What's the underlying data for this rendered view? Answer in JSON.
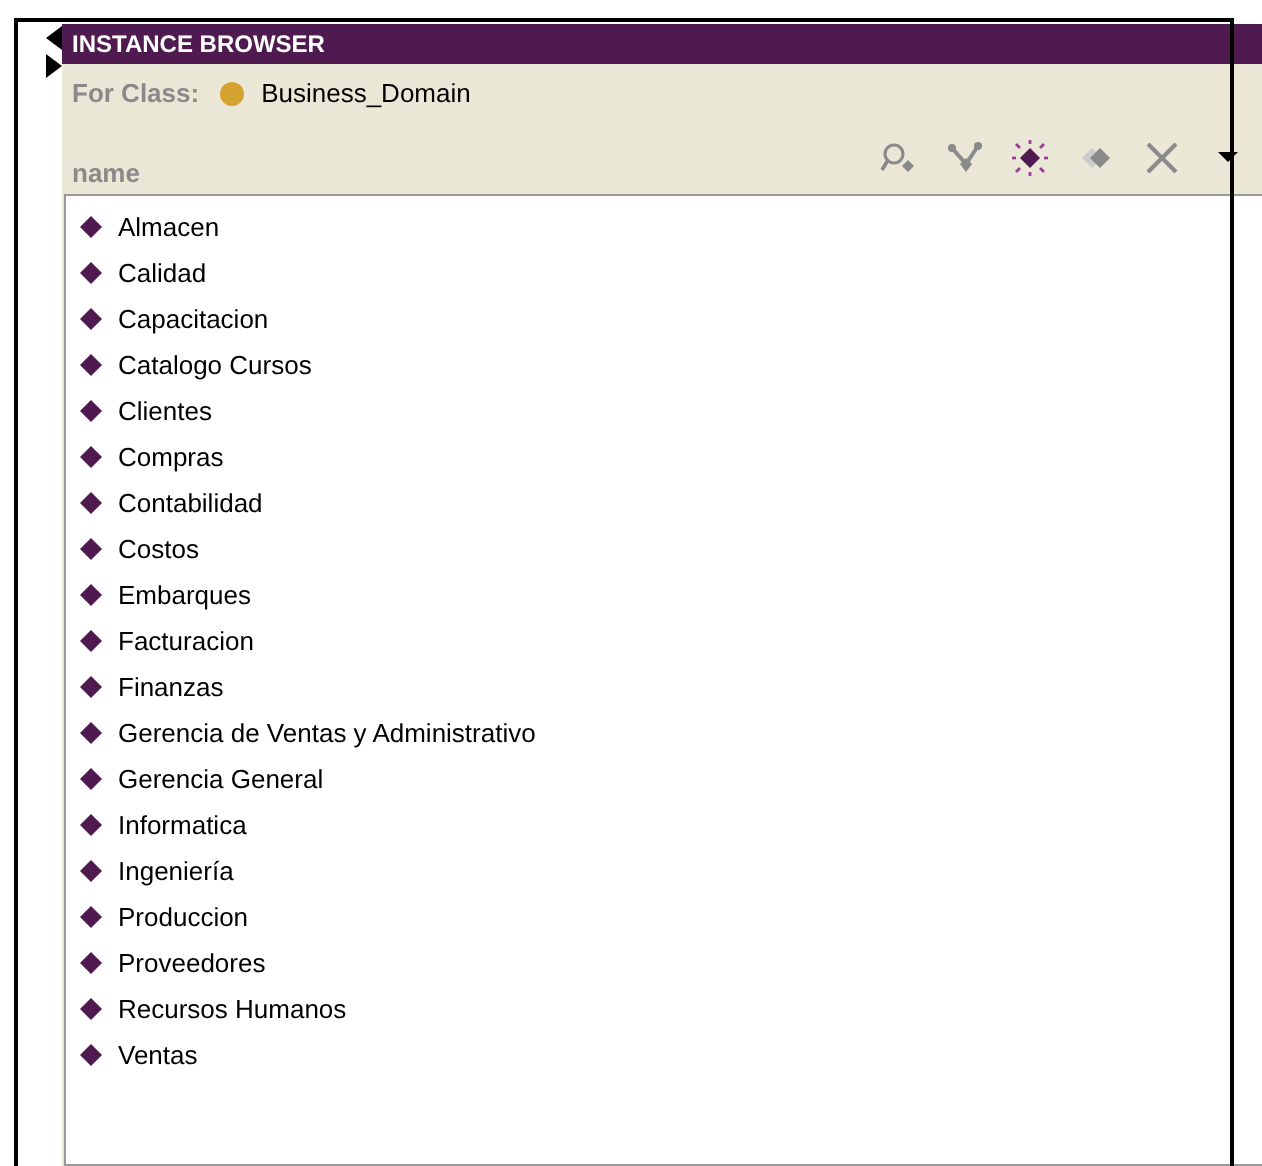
{
  "panel": {
    "title": "INSTANCE BROWSER",
    "class_label": "For Class:",
    "class_name": "Business_Domain",
    "column": "name"
  },
  "toolbar": [
    {
      "kind": "search",
      "disabled": true
    },
    {
      "kind": "references",
      "disabled": true
    },
    {
      "kind": "create",
      "disabled": false
    },
    {
      "kind": "copy",
      "disabled": true
    },
    {
      "kind": "delete",
      "disabled": true
    },
    {
      "kind": "menu",
      "disabled": false
    }
  ],
  "instances": [
    {
      "label": "Almacen"
    },
    {
      "label": "Calidad"
    },
    {
      "label": "Capacitacion"
    },
    {
      "label": "Catalogo Cursos"
    },
    {
      "label": "Clientes"
    },
    {
      "label": "Compras"
    },
    {
      "label": "Contabilidad"
    },
    {
      "label": "Costos"
    },
    {
      "label": "Embarques"
    },
    {
      "label": "Facturacion"
    },
    {
      "label": "Finanzas"
    },
    {
      "label": "Gerencia de Ventas y Administrativo"
    },
    {
      "label": "Gerencia General"
    },
    {
      "label": "Informatica"
    },
    {
      "label": "Ingeniería"
    },
    {
      "label": "Produccion"
    },
    {
      "label": "Proveedores"
    },
    {
      "label": "Recursos Humanos"
    },
    {
      "label": "Ventas"
    }
  ]
}
